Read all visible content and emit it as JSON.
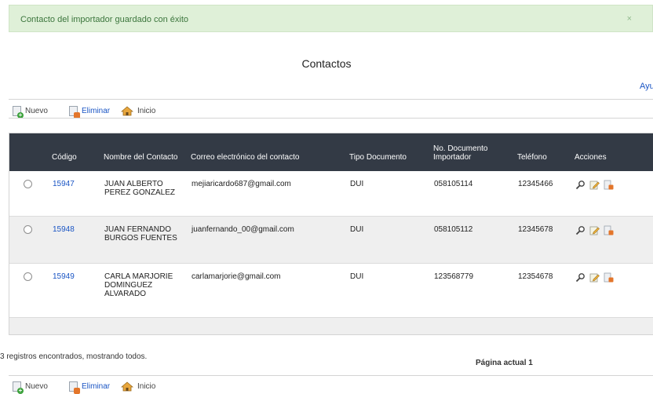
{
  "alert": {
    "message": "Contacto del importador guardado con éxito",
    "close": "×"
  },
  "page": {
    "title": "Contactos",
    "help": "Ayu"
  },
  "toolbar": {
    "new_label": "Nuevo",
    "new_icon": "new-document-icon",
    "delete_label": "Eliminar",
    "delete_icon": "delete-document-icon",
    "home_label": "Inicio",
    "home_icon": "home-icon"
  },
  "table": {
    "columns": [
      "Código",
      "Nombre del Contacto",
      "Correo electrónico del contacto",
      "Tipo Documento",
      "No. Documento Importador",
      "Teléfono",
      "Acciones"
    ],
    "rows": [
      {
        "code": "15947",
        "name": "JUAN ALBERTO PEREZ GONZALEZ",
        "email": "mejiaricardo687@gmail.com",
        "doc_type": "DUI",
        "doc_number": "058105114",
        "phone": "12345466"
      },
      {
        "code": "15948",
        "name": "JUAN FERNANDO BURGOS FUENTES",
        "email": "juanfernando_00@gmail.com",
        "doc_type": "DUI",
        "doc_number": "058105112",
        "phone": "12345678"
      },
      {
        "code": "15949",
        "name": "CARLA MARJORIE DOMINGUEZ ALVARADO",
        "email": "carlamarjorie@gmail.com",
        "doc_type": "DUI",
        "doc_number": "123568779",
        "phone": "12354678"
      }
    ],
    "action_icons": [
      "magnifier-icon",
      "edit-icon",
      "delete-icon"
    ]
  },
  "footer": {
    "records": "3 registros encontrados, mostrando todos.",
    "page": "Página actual 1"
  },
  "colors": {
    "header_bg": "#333a45",
    "alert_bg": "#dff0d8",
    "link": "#1a55c4"
  }
}
